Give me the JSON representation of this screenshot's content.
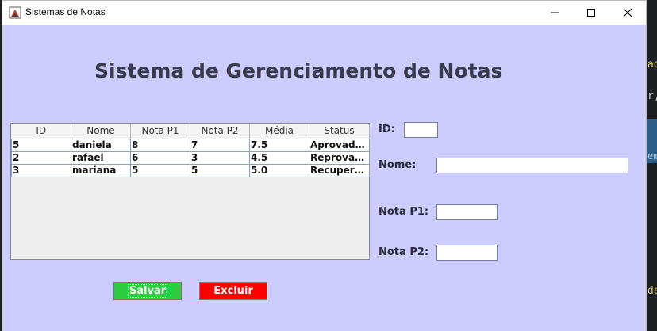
{
  "window": {
    "title": "Sistemas de Notas",
    "controls": {
      "minimize": "—",
      "maximize": "☐",
      "close": "✕"
    }
  },
  "header": {
    "title": "Sistema de Gerenciamento de Notas"
  },
  "table": {
    "columns": [
      "ID",
      "Nome",
      "Nota P1",
      "Nota P2",
      "Média",
      "Status"
    ],
    "rows": [
      [
        "5",
        "daniela",
        "8",
        "7",
        "7.5",
        "Aprovado..."
      ],
      [
        "2",
        "rafael",
        "6",
        "3",
        "4.5",
        "Reprovad..."
      ],
      [
        "3",
        "mariana",
        "5",
        "5",
        "5.0",
        "Recupera..."
      ]
    ]
  },
  "form": {
    "id_label": "ID:",
    "nome_label": "Nome:",
    "p1_label": "Nota P1:",
    "p2_label": "Nota P2:",
    "id_value": "",
    "nome_value": "",
    "p1_value": "",
    "p2_value": ""
  },
  "actions": {
    "save_label": "Salvar",
    "delete_label": "Excluir"
  },
  "background": {
    "snippets": [
      "ad",
      "r,",
      "em",
      "de"
    ]
  },
  "colors": {
    "content_bg": "#ccccff",
    "save": "#2ecc40",
    "delete": "#ff0000"
  }
}
